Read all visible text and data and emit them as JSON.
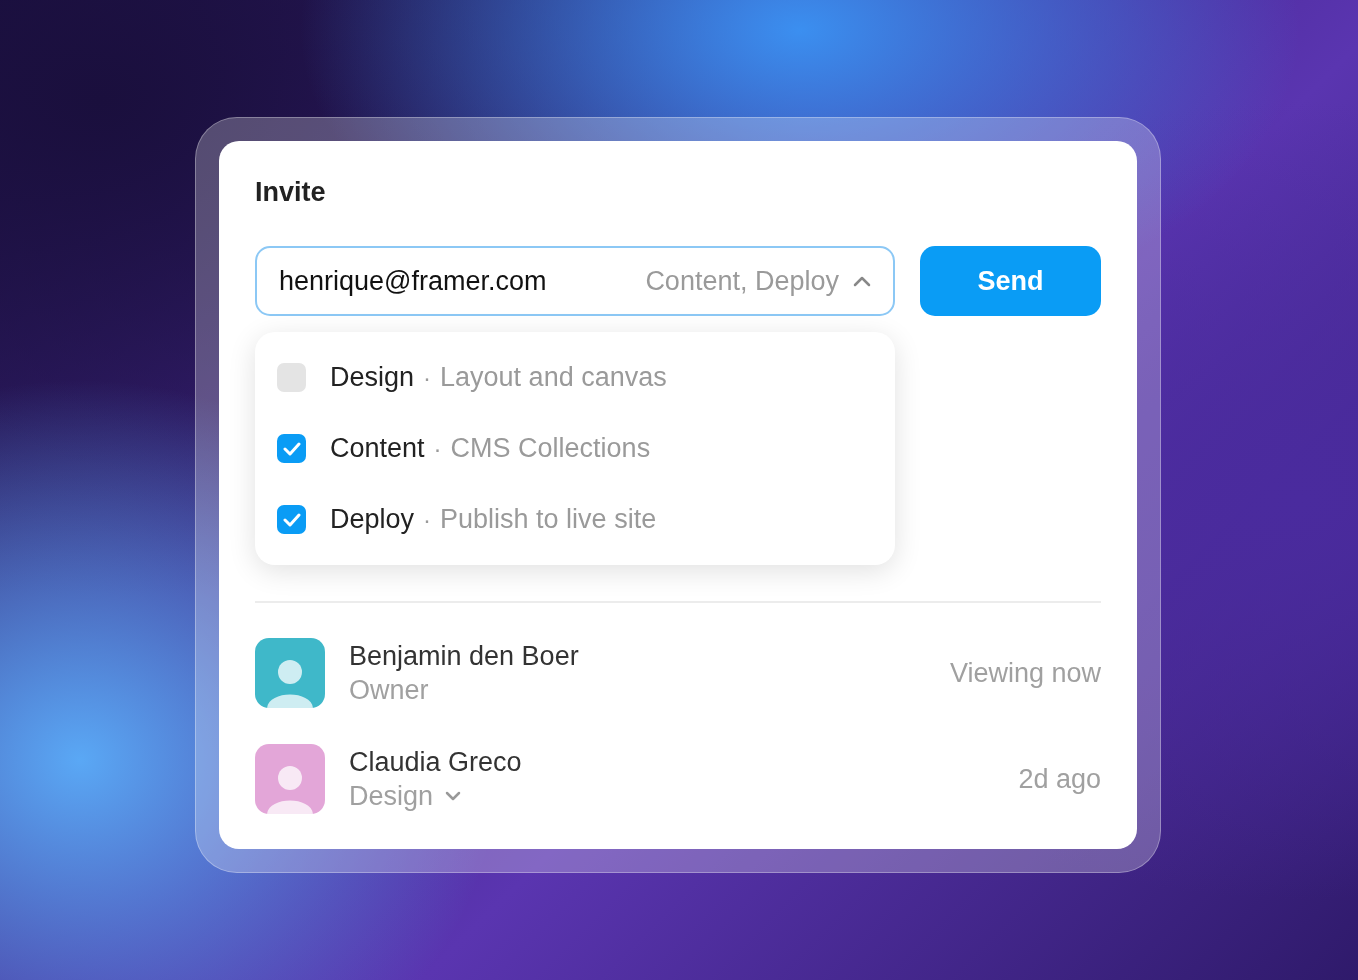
{
  "dialog": {
    "title": "Invite"
  },
  "invite_field": {
    "value": "henrique@framer.com",
    "roles_summary": "Content, Deploy",
    "expanded": true
  },
  "send_button": {
    "label": "Send"
  },
  "role_options": [
    {
      "name": "Design",
      "separator": "·",
      "description": "Layout and canvas",
      "checked": false
    },
    {
      "name": "Content",
      "separator": "·",
      "description": "CMS Collections",
      "checked": true
    },
    {
      "name": "Deploy",
      "separator": "·",
      "description": "Publish to live site",
      "checked": true
    }
  ],
  "members": [
    {
      "name": "Benjamin den Boer",
      "role": "Owner",
      "role_dropdown": false,
      "activity": "Viewing now"
    },
    {
      "name": "Claudia Greco",
      "role": "Design",
      "role_dropdown": true,
      "activity": "2d ago"
    }
  ]
}
